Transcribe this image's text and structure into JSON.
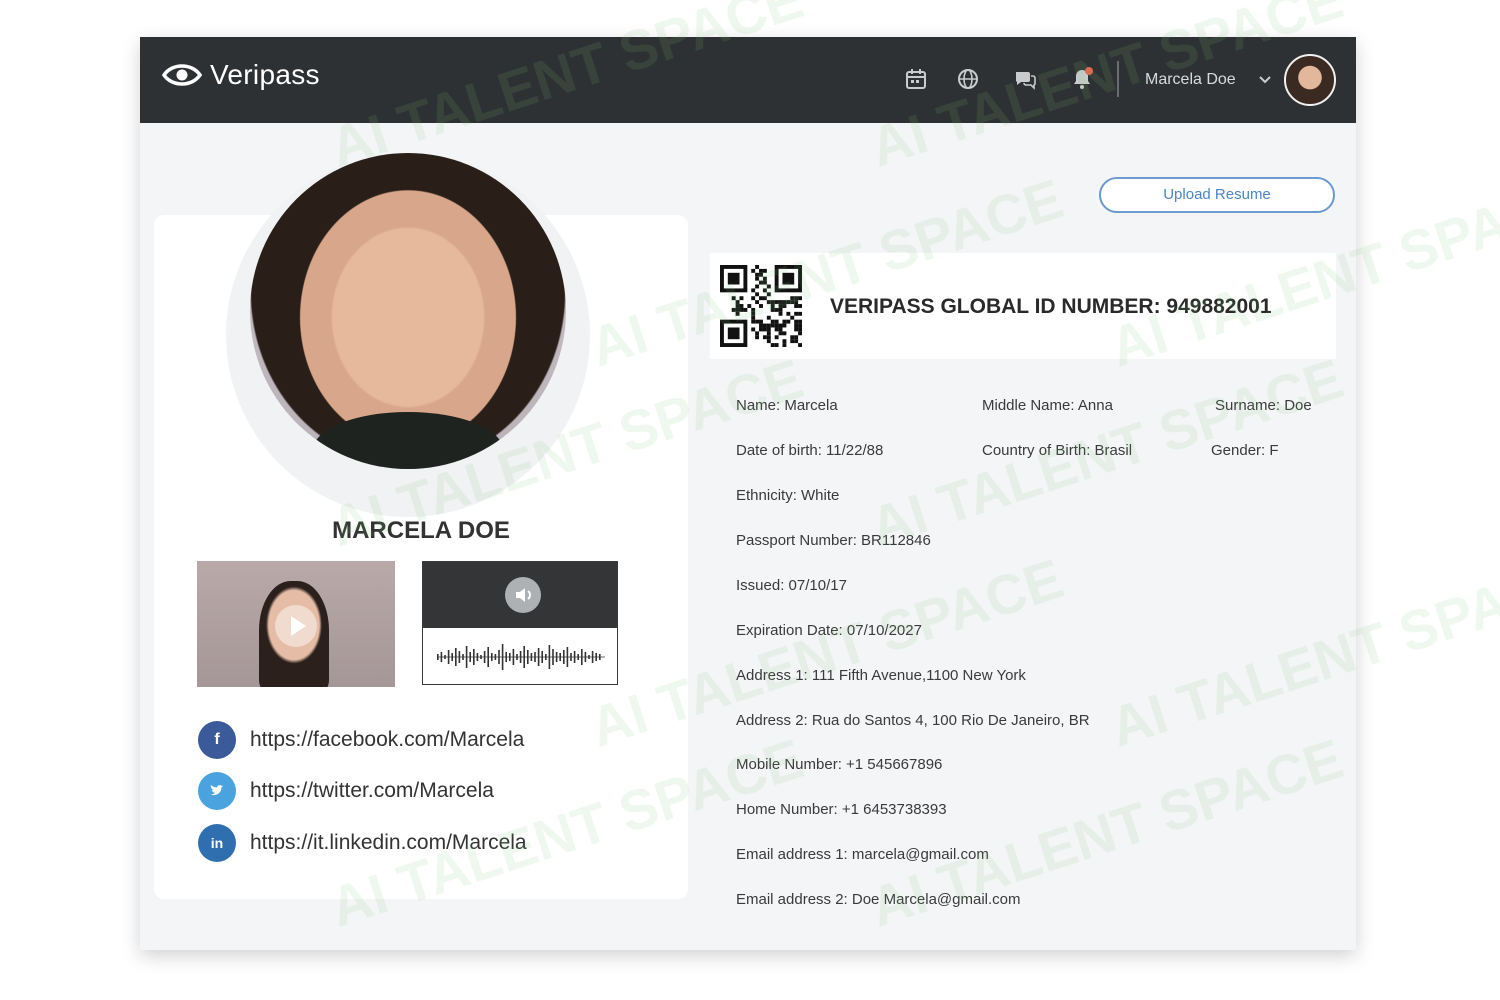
{
  "header": {
    "brand": "Veripass",
    "icons": [
      "calendar-icon",
      "globe-icon",
      "chat-icon",
      "bell-icon"
    ],
    "user_name": "Marcela Doe",
    "colors": {
      "bar": "#2e3133",
      "notification": "#e8614c"
    }
  },
  "profile": {
    "name": "MARCELA DOE",
    "social": [
      {
        "network": "facebook",
        "url": "https://facebook.com/Marcela",
        "color": "#3b5a9a",
        "glyph": "f"
      },
      {
        "network": "twitter",
        "url": "https://twitter.com/Marcela",
        "color": "#4aa3df",
        "glyph": "t"
      },
      {
        "network": "linkedin",
        "url": "https://it.linkedin.com/Marcela",
        "color": "#2f6fb0",
        "glyph": "in"
      }
    ]
  },
  "actions": {
    "upload_resume": "Upload Resume"
  },
  "id_card": {
    "title": "VERIPASS GLOBAL ID NUMBER: 949882001"
  },
  "details": {
    "name": "Name: Marcela",
    "middle_name": "Middle Name: Anna",
    "surname": "Surname: Doe",
    "dob": "Date of birth: 11/22/88",
    "country": "Country of Birth: Brasil",
    "gender": "Gender: F",
    "ethnicity": "Ethnicity: White",
    "passport": "Passport Number: BR112846",
    "issued": "Issued: 07/10/17",
    "expiration": "Expiration Date: 07/10/2027",
    "address1": "Address 1: 111 Fifth Avenue,1100 New York",
    "address2": "Address 2: Rua do Santos 4, 100 Rio De Janeiro, BR",
    "mobile": "Mobile Number: +1 545667896",
    "home": "Home Number: +1 6453738393",
    "email1": "Email address 1: marcela@gmail.com",
    "email2": "Email address 2: Doe Marcela@gmail.com"
  },
  "watermark": "AI TALENT SPACE"
}
